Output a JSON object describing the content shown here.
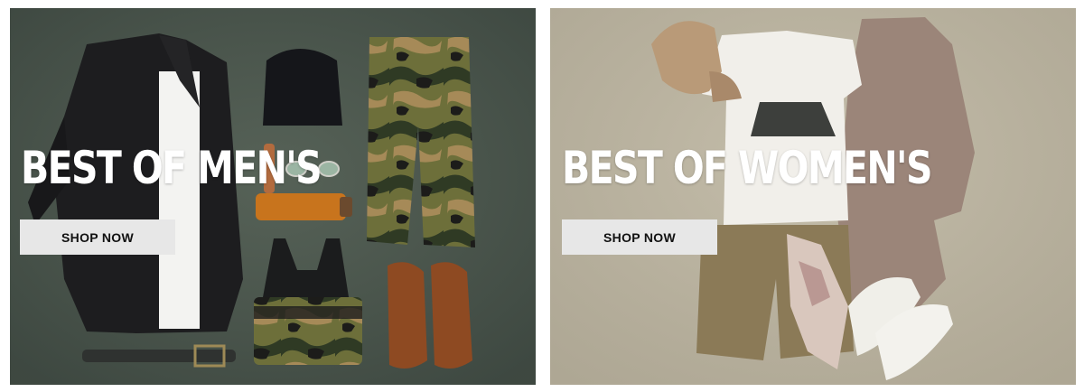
{
  "promos": [
    {
      "headline": "BEST OF MEN'S",
      "button_label": "SHOP NOW"
    },
    {
      "headline": "BEST OF WOMEN'S",
      "button_label": "SHOP NOW"
    }
  ],
  "colors": {
    "men_background": "#4f5a50",
    "women_background": "#bdb6a3",
    "button_background": "#e7e7e7",
    "headline_text": "#ffffff"
  }
}
